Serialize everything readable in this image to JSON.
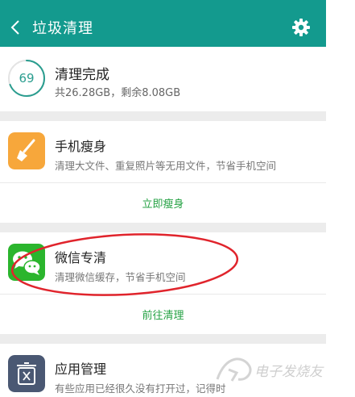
{
  "header": {
    "title": "垃圾清理",
    "back_icon": "chevron-left-icon",
    "settings_icon": "gear-icon",
    "color": "#139a8e"
  },
  "summary": {
    "score": "69",
    "title": "清理完成",
    "detail": "共26.28GB，剩余8.08GB",
    "ring_color": "#2a9d8f",
    "ring_fill_percent": 69
  },
  "cards": [
    {
      "title": "手机瘦身",
      "description": "清理大文件、重复照片等无用文件，节省手机空间",
      "action": "立即瘦身",
      "icon": "shovel-icon",
      "icon_color": "#f7a73b"
    },
    {
      "title": "微信专清",
      "description": "清理微信缓存，节省手机空间",
      "action": "前往清理",
      "icon": "wechat-icon",
      "icon_color": "#2bb52d"
    },
    {
      "title": "应用管理",
      "description": "有些应用已经很久没有打开过，记得时",
      "icon": "app-trash-icon",
      "icon_color": "#4a5873"
    }
  ],
  "action_color": "#25a244",
  "annotation_color": "#e0242c",
  "watermark": {
    "text": "电子发烧友",
    "icon": "logo-icon"
  }
}
